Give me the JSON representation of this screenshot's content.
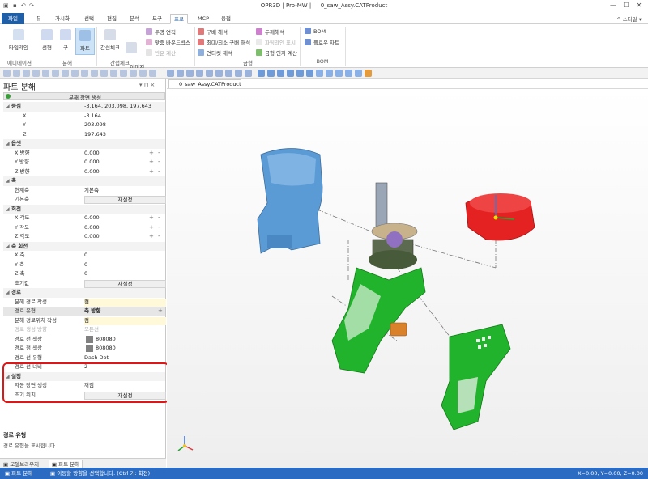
{
  "window": {
    "title": "OPR3D | Pro-MW | — 0_saw_Assy.CATProduct",
    "minimize": "—",
    "maximize": "☐",
    "close": "✕"
  },
  "ribbon_tabs": [
    "파일",
    "뷰",
    "가시화",
    "선택",
    "편집",
    "분석",
    "도구",
    "프로",
    "MCP",
    "응접"
  ],
  "ribbon_right": {
    "help": "^ 스타일 ▾",
    "info": "?"
  },
  "ribbon": {
    "timeline": "타임라인",
    "animation": "애니메이션",
    "linear": "선형",
    "sphere": "구",
    "parts": "파트",
    "disassembly": "분해",
    "interference_check": "간섭체크",
    "image_creation": "이미지\n캡처",
    "interference_group": "간섭체크",
    "transparent_tool": "투명 연직",
    "fit_bound_box": "맞춤 바운드박스",
    "relation_calc": "빈운 계산",
    "draft_analysis": "구배 해석",
    "minmax_draft": "최대/최소 구배 해석",
    "undercut": "언더컷 해석",
    "thickness": "두께해석",
    "parting_line": "파팅라인 표시",
    "mold_factor": "금형 인자 계산",
    "mold_group": "금형",
    "bom": "BOM",
    "flow_chart": "플로우 차트",
    "bom_group": "BOM"
  },
  "panel": {
    "title": "파트 분해",
    "pin": "▾ ⊓ ×",
    "create_label": "분해 장면 생성",
    "rows": [
      {
        "type": "sec",
        "k": "중심",
        "v": "-3.164, 203.098, 197.643"
      },
      {
        "type": "sub",
        "k": "X",
        "v": "-3.164"
      },
      {
        "type": "sub",
        "k": "Y",
        "v": "203.098"
      },
      {
        "type": "sub",
        "k": "Z",
        "v": "197.643"
      },
      {
        "type": "sec",
        "k": "옵셋",
        "v": ""
      },
      {
        "type": "pm",
        "k": "X 방향",
        "v": "0.000"
      },
      {
        "type": "pm",
        "k": "Y 방향",
        "v": "0.000"
      },
      {
        "type": "pm",
        "k": "Z 방향",
        "v": "0.000"
      },
      {
        "type": "sec",
        "k": "축",
        "v": ""
      },
      {
        "type": "row",
        "k": "현재축",
        "v": "기본축"
      },
      {
        "type": "btn",
        "k": "기본축",
        "v": "재설정"
      },
      {
        "type": "sec",
        "k": "회전",
        "v": ""
      },
      {
        "type": "pm",
        "k": "X 각도",
        "v": "0.000"
      },
      {
        "type": "pm",
        "k": "Y 각도",
        "v": "0.000"
      },
      {
        "type": "pm",
        "k": "Z 각도",
        "v": "0.000"
      },
      {
        "type": "sec",
        "k": "축 회전",
        "v": ""
      },
      {
        "type": "row",
        "k": "X 축",
        "v": "0"
      },
      {
        "type": "row",
        "k": "Y 축",
        "v": "0"
      },
      {
        "type": "row",
        "k": "Z 축",
        "v": "0"
      },
      {
        "type": "btn",
        "k": "초기값",
        "v": "재설정"
      },
      {
        "type": "sec",
        "k": "경로",
        "v": ""
      },
      {
        "type": "hl",
        "k": "분해 경로 작성",
        "v": "켬"
      },
      {
        "type": "selpm",
        "k": "경로 유형",
        "v": "축 방향"
      },
      {
        "type": "hl",
        "k": "분해 경로위치 작성",
        "v": "켬"
      },
      {
        "type": "dis",
        "k": "경로 생성 방향",
        "v": "모든선"
      },
      {
        "type": "sw",
        "k": "경로 선 색상",
        "v": "808080"
      },
      {
        "type": "sw",
        "k": "경로 점 색상",
        "v": "808080"
      },
      {
        "type": "row",
        "k": "경로 선 유형",
        "v": "Dash Dot"
      },
      {
        "type": "row",
        "k": "경로 선 너비",
        "v": "2"
      },
      {
        "type": "sec",
        "k": "설정",
        "v": ""
      },
      {
        "type": "row",
        "k": "자동 장면 생성",
        "v": "꺼짐"
      },
      {
        "type": "btn",
        "k": "초기 위치",
        "v": "재설정"
      }
    ],
    "desc_title": "경로 유형",
    "desc_text": "경로 유형을 표시합니다",
    "tabs": [
      "모델브라우저",
      "파트 분해"
    ]
  },
  "doc_tab": "0_saw_Assy.CATProduct",
  "status": {
    "left1": "파트 분해",
    "left2": "이동할 방향을 선택합니다. (Ctrl 키: 회전)",
    "coords": "X=0.00, Y=0.00, Z=0.00"
  },
  "colors": {
    "accent": "#1f5fa8",
    "blue_part": "#5b9bd5",
    "green_part": "#22b32c",
    "red_part": "#e52222",
    "orange_part": "#d9822b",
    "highlight": "#e01515"
  }
}
